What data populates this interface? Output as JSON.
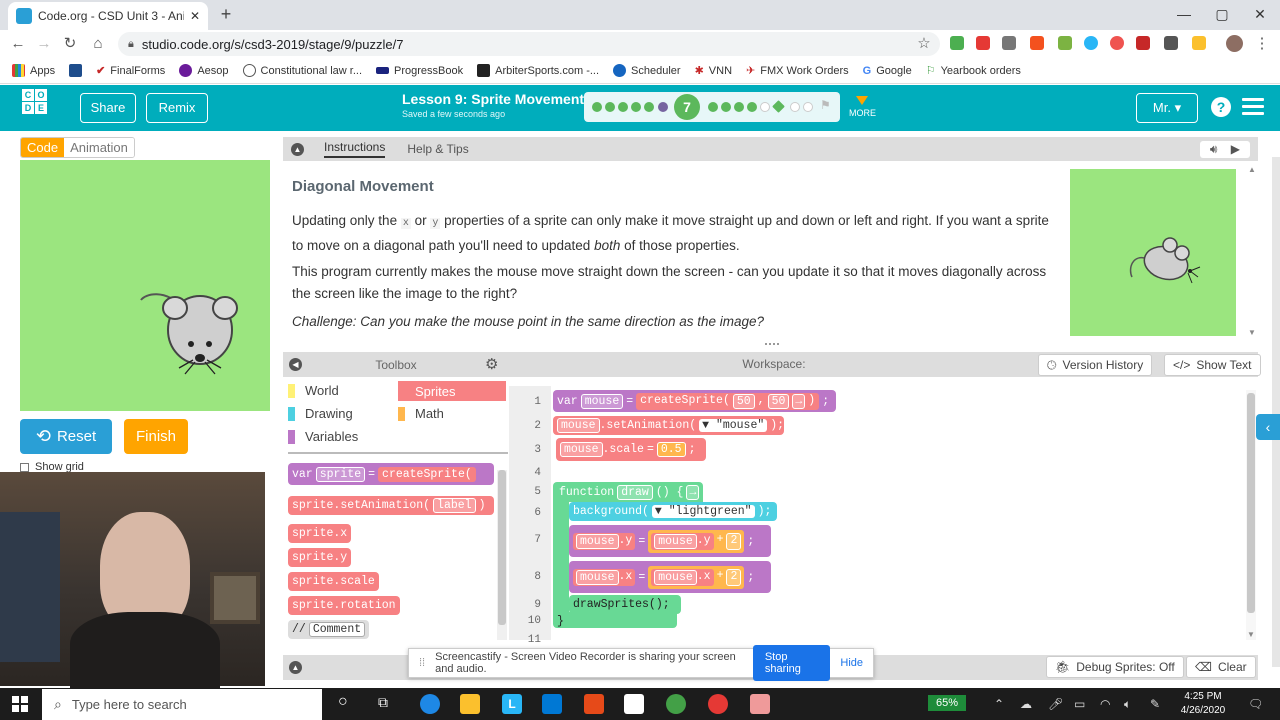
{
  "browser": {
    "tab_title": "Code.org - CSD Unit 3 - Animati",
    "url": "studio.code.org/s/csd3-2019/stage/9/puzzle/7",
    "bookmarks": [
      "Apps",
      "",
      "FinalForms",
      "Aesop",
      "Constitutional law r...",
      "ProgressBook",
      "ArbiterSports.com -...",
      "Scheduler",
      "VNN",
      "FMX Work Orders",
      "Google",
      "Yearbook orders"
    ]
  },
  "header": {
    "logo_letters": [
      "C",
      "O",
      "",
      "D",
      "E",
      ""
    ],
    "share_label": "Share",
    "remix_label": "Remix",
    "lesson_title": "Lesson 9: Sprite Movement",
    "saved_text": "Saved a few seconds ago",
    "current_level": "7",
    "more_label": "MORE",
    "user_label": "Mr.",
    "help_label": "?"
  },
  "left": {
    "code_tab": "Code",
    "animation_tab": "Animation",
    "reset_label": "Reset",
    "finish_label": "Finish",
    "show_grid_label": "Show grid"
  },
  "instructions": {
    "tab_instructions": "Instructions",
    "tab_help": "Help & Tips",
    "title": "Diagonal Movement",
    "p1_a": "Updating only the ",
    "p1_x": "x",
    "p1_b": " or ",
    "p1_y": "y",
    "p1_c": " properties of a sprite can only make it move straight up and down or left and right. If you want a sprite to move on a diagonal path you'll need to updated ",
    "p1_em": "both",
    "p1_d": " of those properties.",
    "p2": "This program currently makes the mouse move straight down the screen - can you update it so that it moves diagonally across the screen like the image to the right?",
    "p3": "Challenge: Can you make the mouse point in the same direction as the image?"
  },
  "toolbox": {
    "title": "Toolbox",
    "categories": [
      "World",
      "Sprites",
      "Drawing",
      "Math",
      "Variables"
    ],
    "blocks": {
      "var_kw": "var",
      "var_name": "sprite",
      "eq": "=",
      "create": "createSprite(",
      "setanim_obj": "sprite",
      "setanim_fn": ".setAnimation(",
      "setanim_arg": "label",
      "setanim_close": ")",
      "sx": "sprite.x",
      "sy": "sprite.y",
      "sscale": "sprite.scale",
      "srot": "sprite.rotation",
      "comment_slash": "//",
      "comment": "Comment"
    }
  },
  "workspace": {
    "title": "Workspace:",
    "version_history": "Version History",
    "show_text": "Show Text",
    "line_numbers": [
      "1",
      "2",
      "3",
      "4",
      "5",
      "6",
      "7",
      "8",
      "9",
      "10",
      "11"
    ],
    "code": {
      "l1_var": "var",
      "l1_name": "mouse",
      "l1_eq": "=",
      "l1_fn": "createSprite(",
      "l1_a": "50",
      "l1_comma": ",",
      "l1_b": "50",
      "l1_close": ")",
      "l1_semi": ";",
      "l2_obj": "mouse",
      "l2_fn": ".setAnimation(",
      "l2_arg": "\"mouse\"",
      "l2_close": ");",
      "l3_obj": "mouse",
      "l3_prop": ".scale",
      "l3_eq": "=",
      "l3_val": "0.5",
      "l3_semi": ";",
      "l5_kw": "function",
      "l5_name": "draw",
      "l5_rest": "() {",
      "l6_fn": "background(",
      "l6_arg": "\"lightgreen\"",
      "l6_close": ");",
      "l7_obj": "mouse",
      "l7_prop": ".y",
      "l7_eq": "=",
      "l7_robj": "mouse",
      "l7_rprop": ".y",
      "l7_plus": "+",
      "l7_num": "2",
      "l7_semi": ";",
      "l8_obj": "mouse",
      "l8_prop": ".x",
      "l8_eq": "=",
      "l8_robj": "mouse",
      "l8_rprop": ".x",
      "l8_plus": "+",
      "l8_num": "2",
      "l8_semi": ";",
      "l9": "drawSprites();",
      "l10": "}"
    }
  },
  "bottom": {
    "debug_sprites": "Debug Sprites: Off",
    "clear": "Clear"
  },
  "castify": {
    "message": "Screencastify - Screen Video Recorder is sharing your screen and audio.",
    "stop": "Stop sharing",
    "hide": "Hide"
  },
  "taskbar": {
    "search_placeholder": "Type here to search",
    "battery": "65%",
    "time": "4:25 PM",
    "date": "4/26/2020"
  },
  "colors": {
    "codeorg_teal": "#00adbc",
    "stage_green": "#9be57f",
    "sprites_red": "#f78183",
    "functions_green": "#68d995",
    "variables_purple": "#bb77c7",
    "math_orange": "#ffb74d",
    "world_yellow": "#fff176",
    "drawing_cyan": "#4dd0e1",
    "reset_blue": "#2a9fd6",
    "finish_orange": "#ffa400"
  }
}
